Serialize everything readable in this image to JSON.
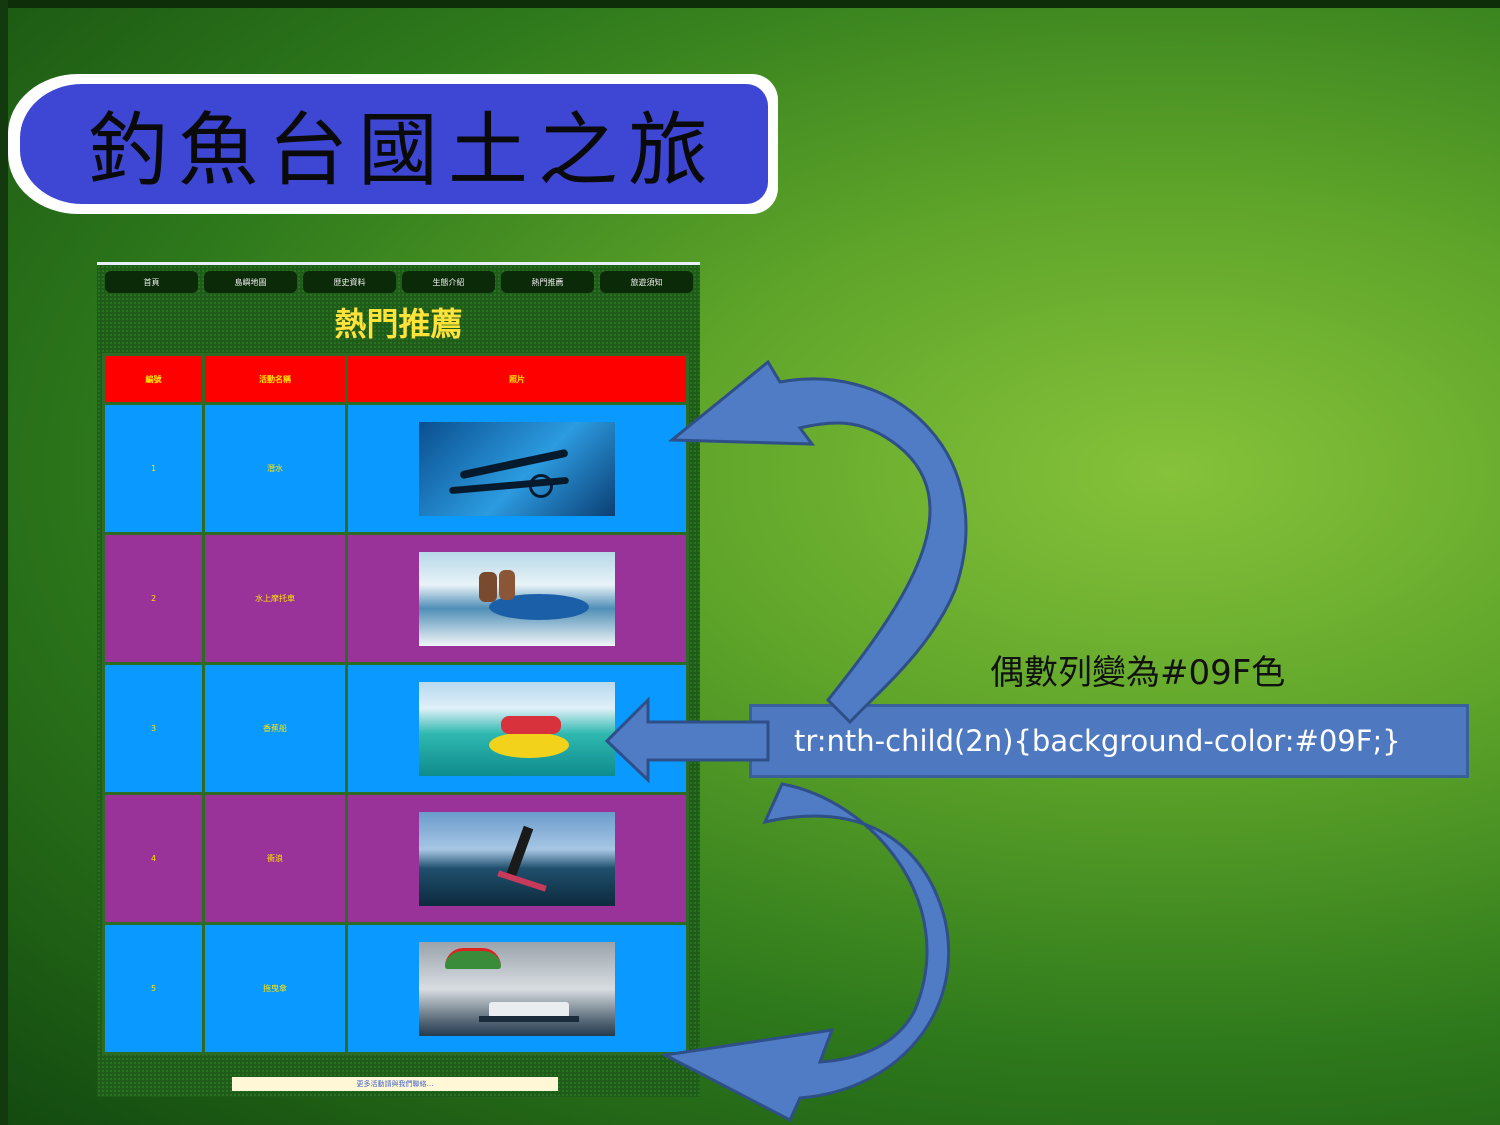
{
  "slide": {
    "title": "釣魚台國土之旅"
  },
  "web_page": {
    "nav_tabs": [
      "首頁",
      "島嶼地圖",
      "歷史資料",
      "生態介紹",
      "熱門推薦",
      "旅遊須知"
    ],
    "heading": "熱門推薦",
    "table_headers": [
      "編號",
      "活動名稱",
      "照片"
    ],
    "rows": [
      {
        "num": "1",
        "name": "潛水",
        "photo": "scuba-diver-photo",
        "color": "#0999ff"
      },
      {
        "num": "2",
        "name": "水上摩托車",
        "photo": "jet-ski-photo",
        "color": "#993399"
      },
      {
        "num": "3",
        "name": "香蕉船",
        "photo": "banana-boat-photo",
        "color": "#0999ff"
      },
      {
        "num": "4",
        "name": "衝浪",
        "photo": "wakeboard-photo",
        "color": "#993399"
      },
      {
        "num": "5",
        "name": "拖曳傘",
        "photo": "parasail-photo",
        "color": "#0999ff"
      }
    ],
    "footer": "更多活動請與我們聯絡…"
  },
  "annotation": {
    "caption": "偶數列變為#09F色",
    "code": "tr:nth-child(2n){background-color:#09F;}"
  },
  "colors": {
    "title_blue": "#3e47d4",
    "header_red": "#ff0000",
    "even_row_blue": "#0999ff",
    "odd_row_purple": "#993399",
    "arrow_blue": "#4f7cc4"
  }
}
